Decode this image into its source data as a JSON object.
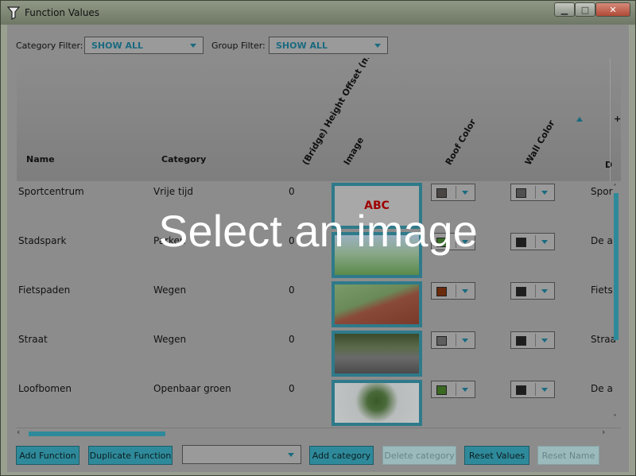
{
  "window": {
    "title": "Function Values",
    "minimize": "▁",
    "maximize": "□",
    "close": "✕"
  },
  "filters": {
    "category_label": "Category Filter:",
    "category_value": "SHOW ALL",
    "group_label": "Group Filter:",
    "group_value": "SHOW ALL"
  },
  "table": {
    "columns": {
      "name": "Name",
      "category": "Category",
      "height_offset": "(Bridge) Height Offset (m)",
      "image": "Image",
      "roof_color": "Roof Color",
      "wall_color": "Wall Color",
      "next": "D",
      "extra": "+"
    },
    "rows": [
      {
        "name": "Sportcentrum",
        "category": "Vrije tijd",
        "offset": "0",
        "image": "ABC",
        "roof_color": "#4a4644",
        "wall_color": "#505050",
        "next": "Spor"
      },
      {
        "name": "Stadspark",
        "category": "Parken",
        "offset": "0",
        "image": "park",
        "roof_color": "#3a6a2a",
        "wall_color": "#1e1e1e",
        "next": "De a"
      },
      {
        "name": "Fietspaden",
        "category": "Wegen",
        "offset": "0",
        "image": "bike path",
        "roof_color": "#6a2a0c",
        "wall_color": "#1e1e1e",
        "next": "Fiets"
      },
      {
        "name": "Straat",
        "category": "Wegen",
        "offset": "0",
        "image": "street",
        "roof_color": "#5e5e5e",
        "wall_color": "#1e1e1e",
        "next": "Straa"
      },
      {
        "name": "Loofbomen",
        "category": "Openbaar groen",
        "offset": "0",
        "image": "trees",
        "roof_color": "#3a6a22",
        "wall_color": "#1e1e1e",
        "next": "De a"
      }
    ]
  },
  "overlay_text": "Select an image",
  "buttons": {
    "add_function": "Add Function",
    "duplicate_function": "Duplicate Function",
    "add_category": "Add category",
    "delete_category": "Delete category",
    "reset_values": "Reset Values",
    "reset_name": "Reset Name"
  },
  "colors": {
    "accent": "#2e8a9a",
    "overlay_dim": "#8c8c8c",
    "abc_text": "#a00000"
  },
  "scroll": {
    "up": "˄",
    "down": "˅",
    "left": "‹",
    "right": "›"
  }
}
